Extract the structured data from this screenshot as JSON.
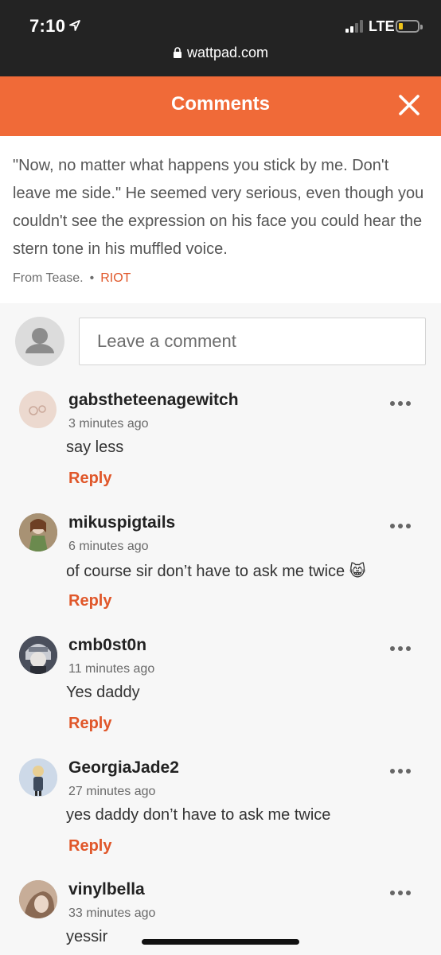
{
  "status_bar": {
    "time": "7:10",
    "network": "LTE",
    "url": "wattpad.com"
  },
  "header": {
    "title": "Comments"
  },
  "quote": {
    "text": "\"Now, no matter what happens you stick by me. Don't leave me side.\" He seemed very serious, even though you couldn't see the expression on his face you could hear the stern tone in his muffled voice.",
    "source_label": "From Tease.",
    "separator": "•",
    "story_tag": "RIOT"
  },
  "compose": {
    "placeholder": "Leave a comment"
  },
  "comments": [
    {
      "username": "gabstheteenagewitch",
      "time": "3 minutes ago",
      "text": "say less",
      "reply": "Reply"
    },
    {
      "username": "mikuspigtails",
      "time": "6 minutes ago",
      "text": "of course sir don’t have to ask me twice 😸",
      "reply": "Reply"
    },
    {
      "username": "cmb0st0n",
      "time": "11 minutes ago",
      "text": "Yes daddy",
      "reply": "Reply"
    },
    {
      "username": "GeorgiaJade2",
      "time": "27 minutes ago",
      "text": "yes daddy don’t have to ask me twice",
      "reply": "Reply"
    },
    {
      "username": "vinylbella",
      "time": "33 minutes ago",
      "text": "yessir",
      "reply": ""
    }
  ],
  "icons": {
    "location": "location-arrow-icon",
    "lock": "lock-icon",
    "close": "close-icon",
    "more": "more-dots-icon",
    "default_avatar": "person-icon"
  },
  "colors": {
    "accent": "#f06a38",
    "link": "#e0572a",
    "status_bar": "#232323",
    "battery": "#f0c419"
  }
}
